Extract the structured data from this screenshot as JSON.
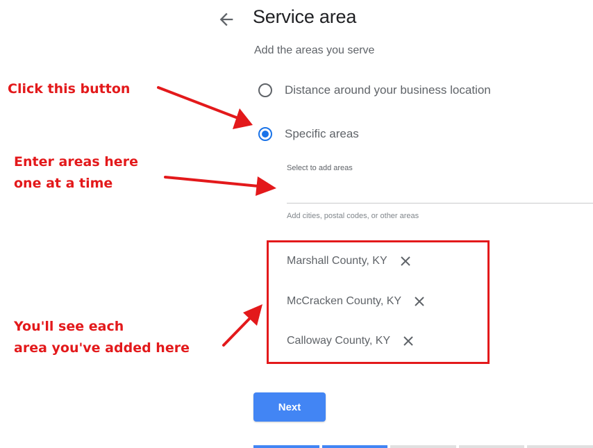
{
  "header": {
    "title": "Service area",
    "back_icon": "arrow-left-icon"
  },
  "subtitle": "Add the areas you serve",
  "radio_options": [
    {
      "label": "Distance around your business location",
      "selected": false
    },
    {
      "label": "Specific areas",
      "selected": true
    }
  ],
  "area_field": {
    "label": "Select to add areas",
    "value": "",
    "helper": "Add cities, postal codes, or other areas"
  },
  "added_areas": [
    {
      "name": "Marshall County, KY",
      "remove_icon": "close-icon"
    },
    {
      "name": "McCracken County, KY",
      "remove_icon": "close-icon"
    },
    {
      "name": "Calloway County, KY",
      "remove_icon": "close-icon"
    }
  ],
  "next_button": {
    "label": "Next"
  },
  "progress": {
    "completed_fraction": 0.3
  },
  "annotations": {
    "click_button": "Click this button",
    "enter_areas": [
      "Enter areas here",
      "one at a time"
    ],
    "see_areas": [
      "You'll see each",
      "area you've added here"
    ]
  },
  "colors": {
    "annotation_red": "#e3191b",
    "accent_blue": "#1a73e8",
    "button_blue": "#4285f4"
  }
}
